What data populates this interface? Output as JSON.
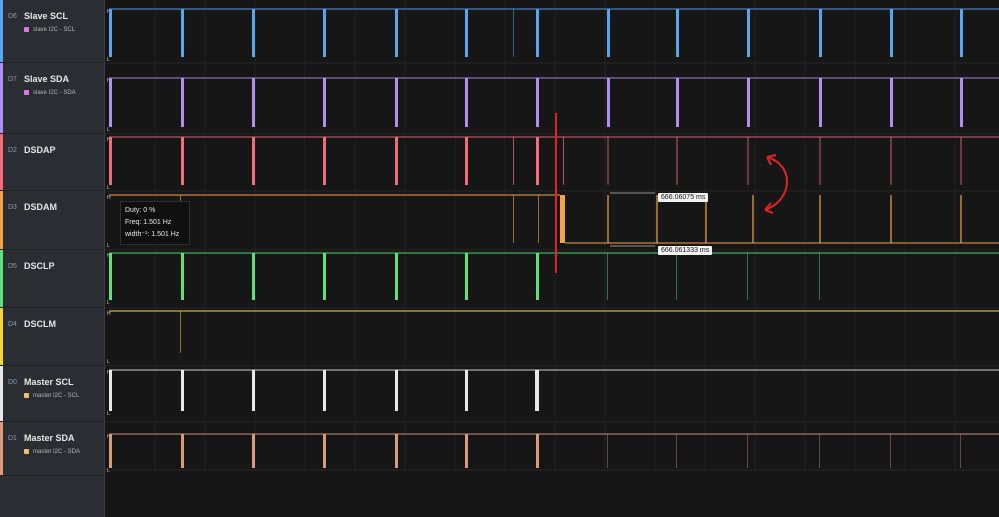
{
  "channels": [
    {
      "id": "D6",
      "name": "Slave SCL",
      "analyzer": "slave I2C - SCL",
      "color": "#58a6f0",
      "dot": "#e178e8"
    },
    {
      "id": "D7",
      "name": "Slave SDA",
      "analyzer": "slave I2C - SDA",
      "color": "#b08ff0",
      "dot": "#e178e8"
    },
    {
      "id": "D2",
      "name": "DSDAP",
      "analyzer": "",
      "color": "#f26c7a",
      "dot": ""
    },
    {
      "id": "D3",
      "name": "DSDAM",
      "analyzer": "",
      "color": "#f0a34a",
      "dot": ""
    },
    {
      "id": "D5",
      "name": "DSCLP",
      "analyzer": "",
      "color": "#5ee07a",
      "dot": ""
    },
    {
      "id": "D4",
      "name": "DSCLM",
      "analyzer": "",
      "color": "#f5d33b",
      "dot": ""
    },
    {
      "id": "D0",
      "name": "Master SCL",
      "analyzer": "master I2C - SCL",
      "color": "#e8e8e8",
      "dot": "#f0c070"
    },
    {
      "id": "D1",
      "name": "Master SDA",
      "analyzer": "master I2C - SDA",
      "color": "#d99b7a",
      "dot": "#f0c070"
    }
  ],
  "tooltip": {
    "duty": "Duty: 0 %",
    "freq": "Freq: 1.501 Hz",
    "width": "width⁻¹: 1.501 Hz"
  },
  "markers": {
    "upper": "666.06075 ms",
    "lower": "666.061333 ms"
  },
  "level_high": "H",
  "level_low": "L"
}
